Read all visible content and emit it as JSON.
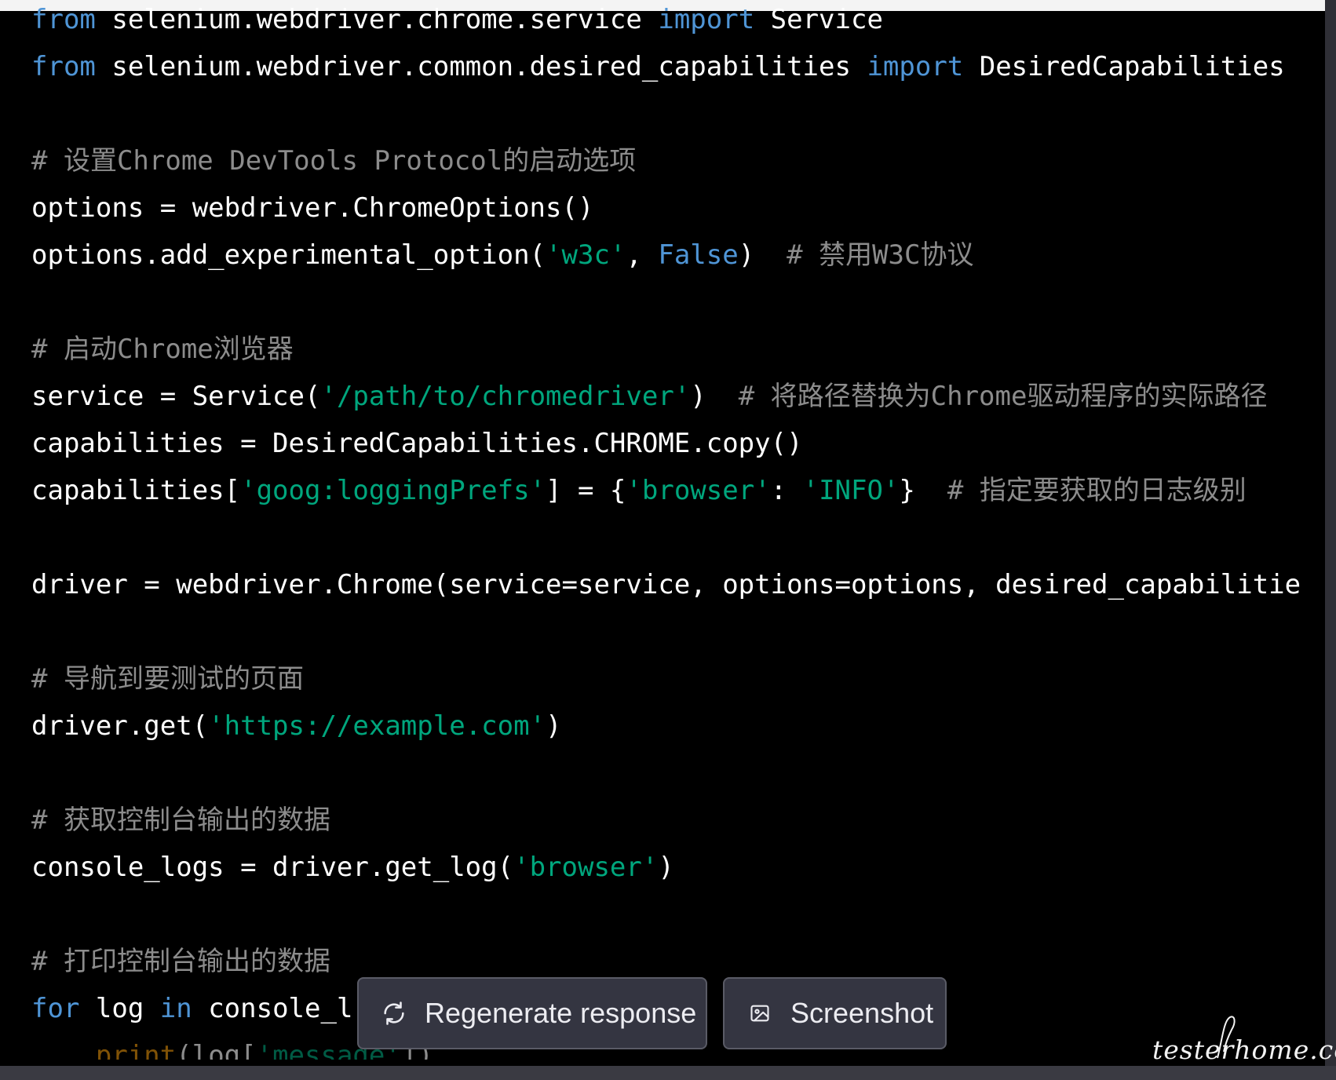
{
  "code": {
    "lines": [
      {
        "tokens": [
          {
            "t": "from",
            "c": "kw"
          },
          {
            "t": " selenium.webdriver.chrome.service ",
            "c": ""
          },
          {
            "t": "import",
            "c": "kw"
          },
          {
            "t": " Service",
            "c": ""
          }
        ]
      },
      {
        "tokens": [
          {
            "t": "from",
            "c": "kw"
          },
          {
            "t": " selenium.webdriver.common.desired_capabilities ",
            "c": ""
          },
          {
            "t": "import",
            "c": "kw"
          },
          {
            "t": " DesiredCapabilities",
            "c": ""
          }
        ]
      },
      {
        "tokens": []
      },
      {
        "tokens": [
          {
            "t": "# 设置Chrome DevTools Protocol的启动选项",
            "c": "cmt"
          }
        ]
      },
      {
        "tokens": [
          {
            "t": "options = webdriver.ChromeOptions()",
            "c": ""
          }
        ]
      },
      {
        "tokens": [
          {
            "t": "options.add_experimental_option(",
            "c": ""
          },
          {
            "t": "'w3c'",
            "c": "str"
          },
          {
            "t": ", ",
            "c": ""
          },
          {
            "t": "False",
            "c": "kw"
          },
          {
            "t": ")  ",
            "c": ""
          },
          {
            "t": "# 禁用W3C协议",
            "c": "cmt"
          }
        ]
      },
      {
        "tokens": []
      },
      {
        "tokens": [
          {
            "t": "# 启动Chrome浏览器",
            "c": "cmt"
          }
        ]
      },
      {
        "tokens": [
          {
            "t": "service = Service(",
            "c": ""
          },
          {
            "t": "'/path/to/chromedriver'",
            "c": "str"
          },
          {
            "t": ")  ",
            "c": ""
          },
          {
            "t": "# 将路径替换为Chrome驱动程序的实际路径",
            "c": "cmt"
          }
        ]
      },
      {
        "tokens": [
          {
            "t": "capabilities = DesiredCapabilities.CHROME.copy()",
            "c": ""
          }
        ]
      },
      {
        "tokens": [
          {
            "t": "capabilities[",
            "c": ""
          },
          {
            "t": "'goog:loggingPrefs'",
            "c": "str"
          },
          {
            "t": "] = {",
            "c": ""
          },
          {
            "t": "'browser'",
            "c": "str"
          },
          {
            "t": ": ",
            "c": ""
          },
          {
            "t": "'INFO'",
            "c": "str"
          },
          {
            "t": "}  ",
            "c": ""
          },
          {
            "t": "# 指定要获取的日志级别",
            "c": "cmt"
          }
        ]
      },
      {
        "tokens": []
      },
      {
        "tokens": [
          {
            "t": "driver = webdriver.Chrome(service=service, options=options, desired_capabilitie",
            "c": ""
          }
        ]
      },
      {
        "tokens": []
      },
      {
        "tokens": [
          {
            "t": "# 导航到要测试的页面",
            "c": "cmt"
          }
        ]
      },
      {
        "tokens": [
          {
            "t": "driver.get(",
            "c": ""
          },
          {
            "t": "'https://example.com'",
            "c": "str"
          },
          {
            "t": ")",
            "c": ""
          }
        ]
      },
      {
        "tokens": []
      },
      {
        "tokens": [
          {
            "t": "# 获取控制台输出的数据",
            "c": "cmt"
          }
        ]
      },
      {
        "tokens": [
          {
            "t": "console_logs = driver.get_log(",
            "c": ""
          },
          {
            "t": "'browser'",
            "c": "str"
          },
          {
            "t": ")",
            "c": ""
          }
        ]
      },
      {
        "tokens": []
      },
      {
        "tokens": [
          {
            "t": "# 打印控制台输出的数据",
            "c": "cmt"
          }
        ]
      },
      {
        "tokens": [
          {
            "t": "for",
            "c": "kw"
          },
          {
            "t": " log ",
            "c": ""
          },
          {
            "t": "in",
            "c": "kw"
          },
          {
            "t": " console_l",
            "c": ""
          }
        ]
      },
      {
        "tokens": [
          {
            "t": "    ",
            "c": ""
          },
          {
            "t": "print",
            "c": "bi"
          },
          {
            "t": "(log[",
            "c": ""
          },
          {
            "t": "'message'",
            "c": "str"
          },
          {
            "t": "])",
            "c": ""
          }
        ],
        "faded": true
      }
    ]
  },
  "buttons": {
    "regenerate_label": "Regenerate response",
    "regenerate_icon": "refresh-icon",
    "screenshot_label": "Screenshot",
    "screenshot_icon": "image-icon"
  },
  "watermark": {
    "text": "testerhome.com"
  },
  "colors": {
    "background": "#000000",
    "keyword": "#4f95d6",
    "string": "#00a67d",
    "comment": "#8c8c8c",
    "builtin": "#e9950c",
    "button_bg": "#343541"
  }
}
